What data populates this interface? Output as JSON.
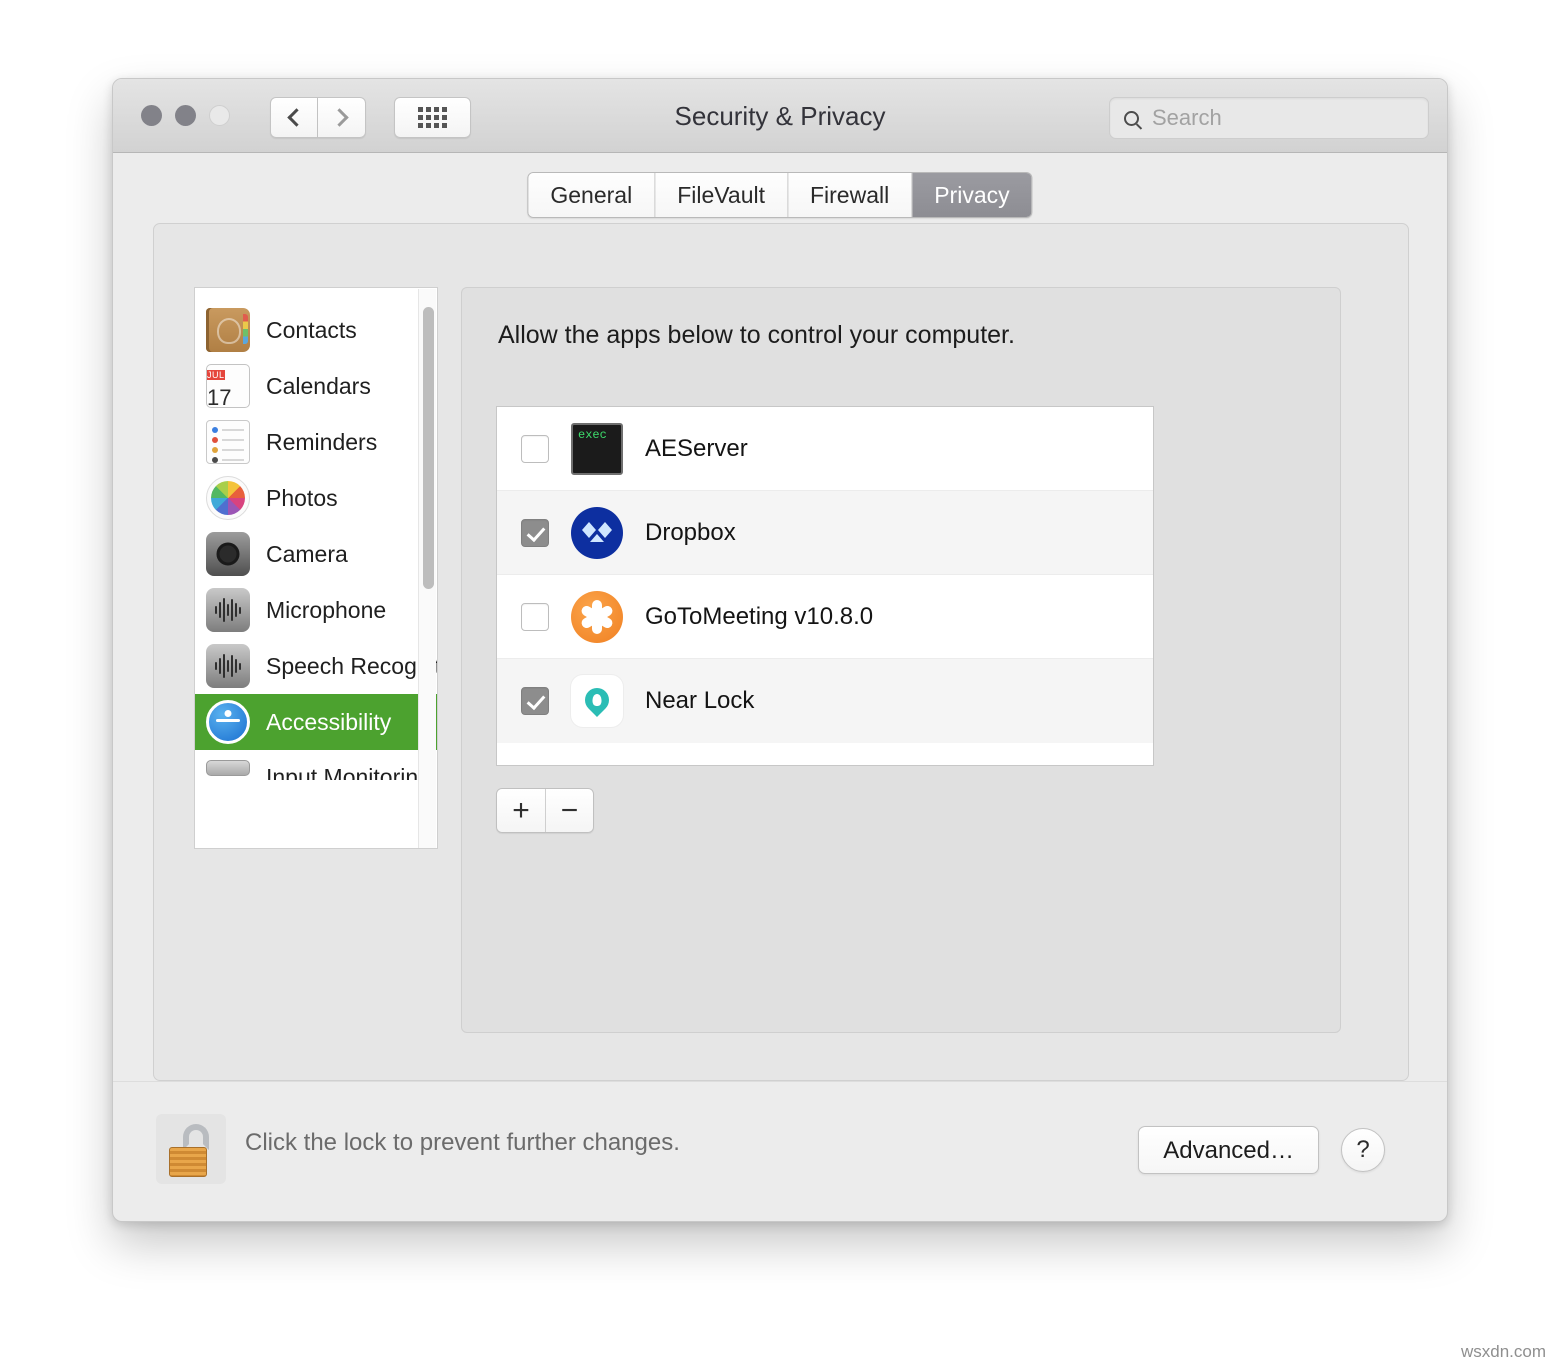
{
  "window": {
    "title": "Security & Privacy",
    "traffic_lights": [
      "close",
      "minimize",
      "zoom"
    ],
    "nav": {
      "back": "back-chevron",
      "forward": "forward-chevron",
      "show_all": "grid-icon"
    },
    "search": {
      "placeholder": "Search",
      "icon": "search-icon",
      "value": ""
    }
  },
  "tabs": [
    {
      "label": "General",
      "active": false
    },
    {
      "label": "FileVault",
      "active": false
    },
    {
      "label": "Firewall",
      "active": false
    },
    {
      "label": "Privacy",
      "active": true
    }
  ],
  "sidebar": {
    "partial_top": {
      "label": "",
      "icon": "full-disk-access-icon"
    },
    "items": [
      {
        "label": "Contacts",
        "icon": "contacts-icon",
        "selected": false
      },
      {
        "label": "Calendars",
        "icon": "calendar-icon",
        "selected": false,
        "cal_month": "JUL",
        "cal_day": "17"
      },
      {
        "label": "Reminders",
        "icon": "reminders-icon",
        "selected": false
      },
      {
        "label": "Photos",
        "icon": "photos-icon",
        "selected": false
      },
      {
        "label": "Camera",
        "icon": "camera-icon",
        "selected": false
      },
      {
        "label": "Microphone",
        "icon": "waveform-icon",
        "selected": false
      },
      {
        "label": "Speech Recognition",
        "icon": "waveform-icon",
        "selected": false
      },
      {
        "label": "Accessibility",
        "icon": "accessibility-icon",
        "selected": true
      }
    ],
    "partial_bottom": {
      "label": "Input Monitoring",
      "icon": "input-monitoring-icon"
    },
    "selected_color": "#4ca22f",
    "scrollbar": {
      "visible": true
    }
  },
  "panel": {
    "heading": "Allow the apps below to control your computer.",
    "apps": [
      {
        "name": "AEServer",
        "checked": false,
        "icon": "exec-terminal-icon"
      },
      {
        "name": "Dropbox",
        "checked": true,
        "icon": "dropbox-icon"
      },
      {
        "name": "GoToMeeting v10.8.0",
        "checked": false,
        "icon": "gotomeeting-icon"
      },
      {
        "name": "Near Lock",
        "checked": true,
        "icon": "nearlock-pin-icon"
      }
    ],
    "add_label": "+",
    "remove_label": "−"
  },
  "footer": {
    "lock_icon": "unlocked-padlock-icon",
    "lock_text": "Click the lock to prevent further changes.",
    "advanced_label": "Advanced…",
    "help_label": "?"
  },
  "watermark": "wsxdn.com"
}
